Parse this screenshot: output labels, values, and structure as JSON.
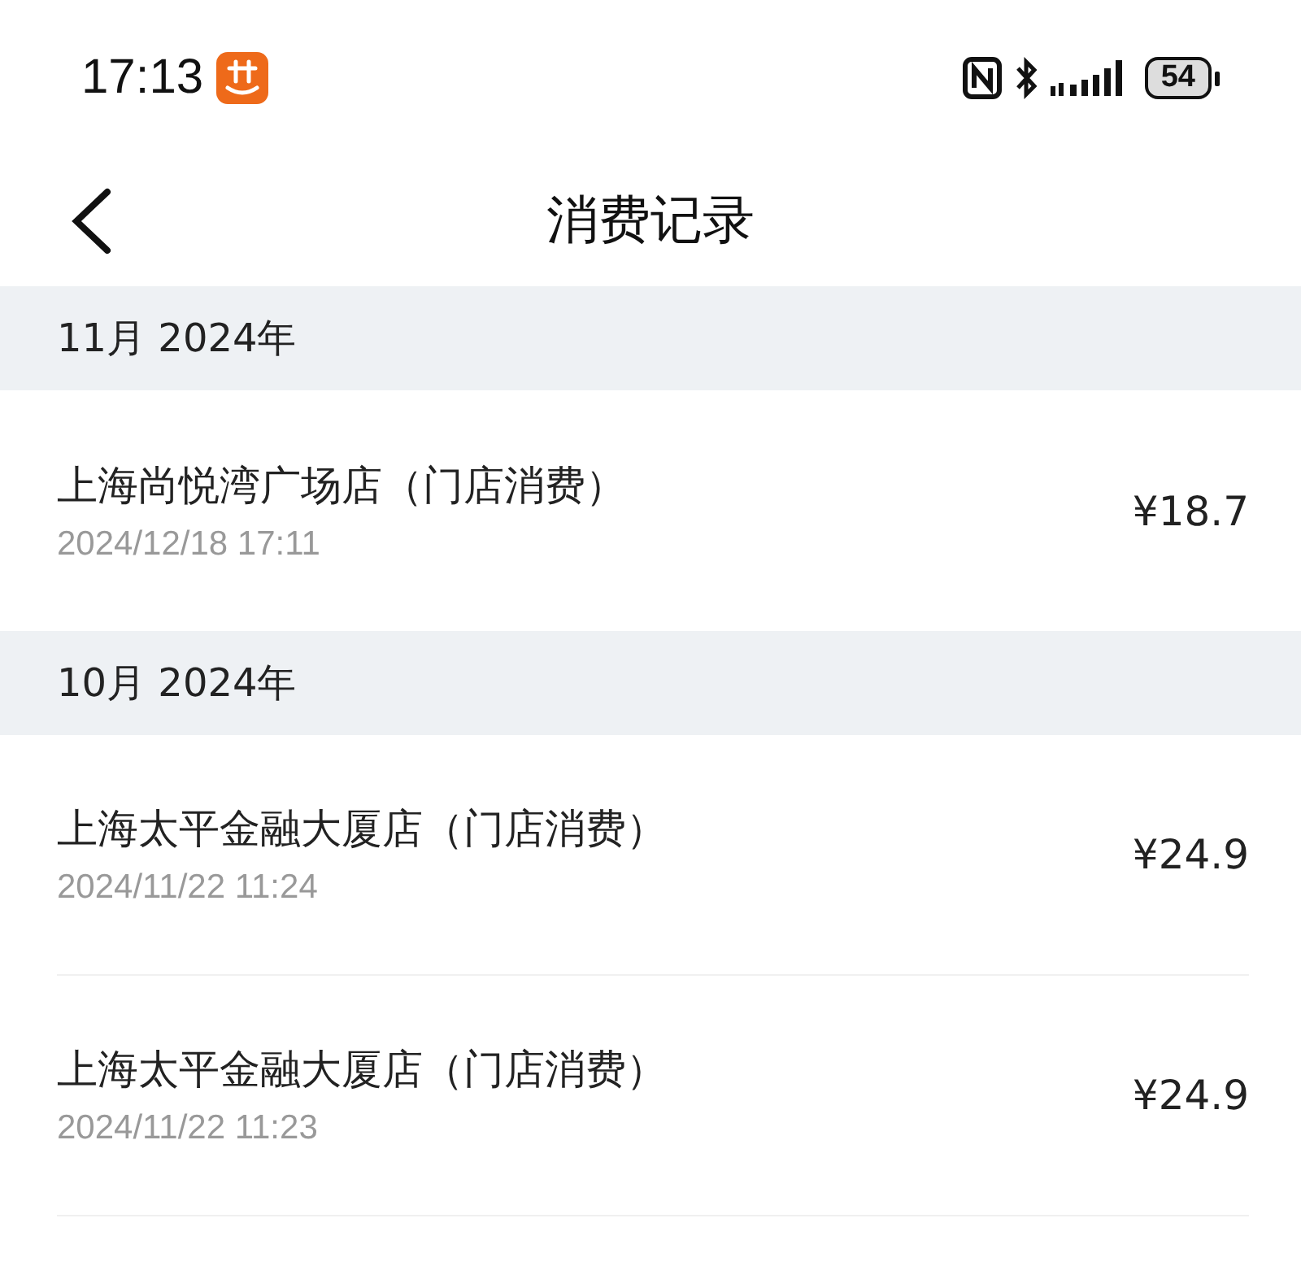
{
  "status_bar": {
    "time": "17:13",
    "battery": "54"
  },
  "header": {
    "title": "消费记录"
  },
  "sections": [
    {
      "month": "11月 2024年",
      "records": [
        {
          "store": "上海尚悦湾广场店（门店消费）",
          "time": "2024/12/18 17:11",
          "amount": "¥18.7"
        }
      ]
    },
    {
      "month": "10月 2024年",
      "records": [
        {
          "store": "上海太平金融大厦店（门店消费）",
          "time": "2024/11/22 11:24",
          "amount": "¥24.9"
        },
        {
          "store": "上海太平金融大厦店（门店消费）",
          "time": "2024/11/22 11:23",
          "amount": "¥24.9"
        }
      ]
    }
  ]
}
